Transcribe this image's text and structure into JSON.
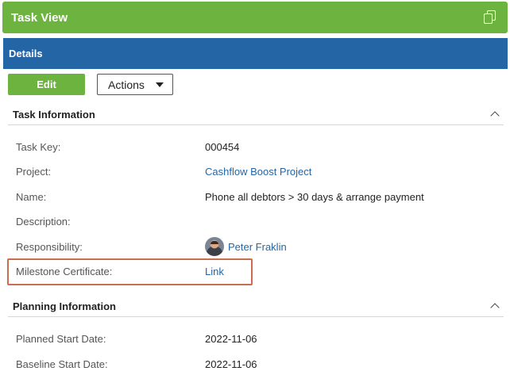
{
  "window": {
    "title": "Task View",
    "icon": "copy-icon"
  },
  "details": {
    "heading": "Details"
  },
  "toolbar": {
    "edit_label": "Edit",
    "actions_label": "Actions"
  },
  "sections": {
    "task_info": {
      "title": "Task Information",
      "fields": {
        "task_key": {
          "label": "Task Key:",
          "value": "000454"
        },
        "project": {
          "label": "Project:",
          "value": "Cashflow Boost Project"
        },
        "name": {
          "label": "Name:",
          "value": "Phone all debtors > 30 days & arrange payment"
        },
        "description": {
          "label": "Description:",
          "value": ""
        },
        "responsibility": {
          "label": "Responsibility:",
          "value": "Peter Fraklin"
        },
        "milestone": {
          "label": "Milestone Certificate:",
          "value": "Link"
        }
      }
    },
    "planning_info": {
      "title": "Planning Information",
      "fields": {
        "planned_start": {
          "label": "Planned Start Date:",
          "value": "2022-11-06"
        },
        "baseline_start": {
          "label": "Baseline Start Date:",
          "value": "2022-11-06"
        }
      }
    }
  },
  "colors": {
    "green": "#6db33f",
    "blue": "#2465a6",
    "highlight": "#c96f50",
    "link": "#2465a6"
  }
}
